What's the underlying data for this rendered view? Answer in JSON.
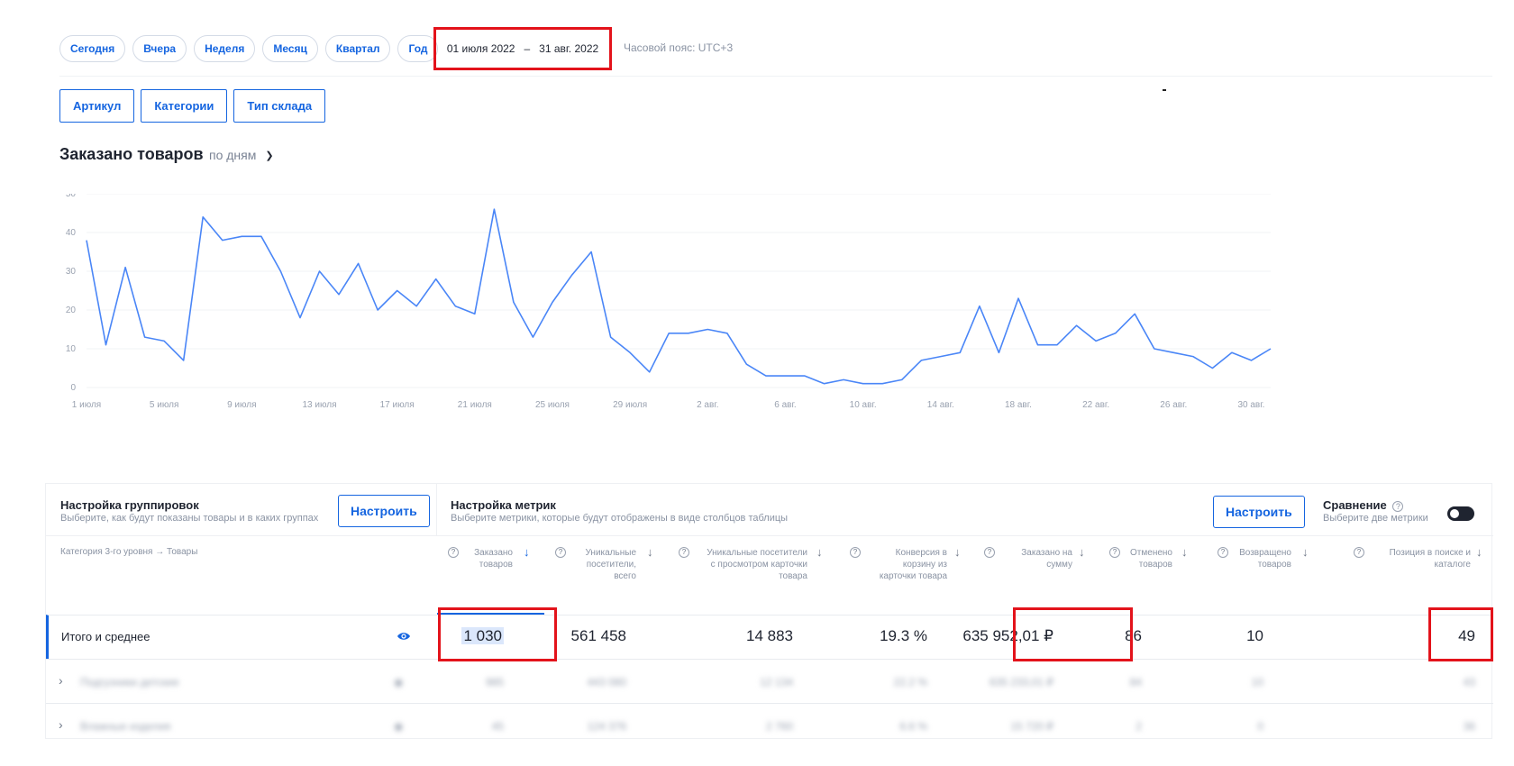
{
  "periods": [
    "Сегодня",
    "Вчера",
    "Неделя",
    "Месяц",
    "Квартал",
    "Год"
  ],
  "date_range": {
    "from": "01 июля 2022",
    "sep": "–",
    "to": "31 авг. 2022"
  },
  "timezone": "Часовой пояс: UTC+3",
  "groupings": [
    "Артикул",
    "Категории",
    "Тип склада"
  ],
  "chart_heading": {
    "title": "Заказано товаров",
    "mode": "по дням"
  },
  "chart_data": {
    "type": "line",
    "x_ticks": [
      "1 июля",
      "5 июля",
      "9 июля",
      "13 июля",
      "17 июля",
      "21 июля",
      "25 июля",
      "29 июля",
      "2 авг.",
      "6 авг.",
      "10 авг.",
      "14 авг.",
      "18 авг.",
      "22 авг.",
      "26 авг.",
      "30 авг."
    ],
    "yticks": [
      0,
      10,
      20,
      30,
      40,
      50
    ],
    "ylim": [
      0,
      50
    ],
    "series": [
      {
        "values": [
          38,
          11,
          31,
          13,
          12,
          7,
          44,
          38,
          39,
          39,
          30,
          18,
          30,
          24,
          32,
          20,
          25,
          21,
          28,
          21,
          19,
          46,
          22,
          13,
          22,
          29,
          35,
          13,
          9,
          4,
          14,
          14,
          15,
          14,
          6,
          3,
          3,
          3,
          1,
          2,
          1,
          1,
          2,
          7,
          8,
          9,
          21,
          9,
          23,
          11,
          11,
          16,
          12,
          14,
          19,
          10,
          9,
          8,
          5,
          9,
          7,
          10
        ]
      }
    ],
    "color": "#4a86f7"
  },
  "table": {
    "group_settings": {
      "title": "Настройка группировок",
      "subtitle": "Выберите, как будут показаны товары и в каких группах",
      "button": "Настроить"
    },
    "metric_settings": {
      "title": "Настройка метрик",
      "subtitle": "Выберите метрики, которые будут отображены в виде столбцов таблицы",
      "button": "Настроить"
    },
    "comparison": {
      "title": "Сравнение",
      "subtitle": "Выберите две метрики",
      "help": "?"
    },
    "category_label": "Категория 3-го уровня → Товары",
    "columns": [
      {
        "label": "Заказано товаров",
        "active": true
      },
      {
        "label": "Уникальные посетители, всего"
      },
      {
        "label": "Уникальные посетители с просмотром карточки товара"
      },
      {
        "label": "Конверсия в корзину из карточки товара"
      },
      {
        "label": "Заказано на сумму"
      },
      {
        "label": "Отменено товаров"
      },
      {
        "label": "Возвращено товаров"
      },
      {
        "label": "Позиция в поиске и каталоге"
      }
    ],
    "help_mark": "?",
    "sort_arrow": "↓",
    "total_row": {
      "name": "Итого и среднее",
      "values": [
        "1 030",
        "561 458",
        "14 883",
        "19.3 %",
        "635 952,01 ₽",
        "86",
        "10",
        "49"
      ]
    },
    "blurred_rows": [
      {
        "name": "Подгузники детские",
        "values": [
          "985",
          "443 080",
          "12 134",
          "22.2 %",
          "635 233,01 ₽",
          "84",
          "10",
          "43"
        ]
      },
      {
        "name": "Влажные изделия",
        "values": [
          "45",
          "124 376",
          "2 760",
          "6.6 %",
          "15 720 ₽",
          "2",
          "0",
          "36"
        ]
      }
    ],
    "expand_chevron": "›"
  }
}
